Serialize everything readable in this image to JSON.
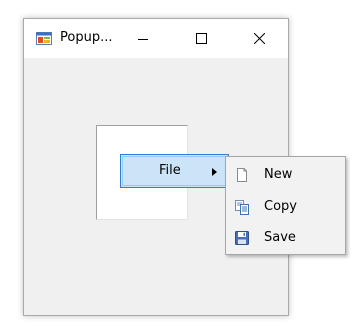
{
  "window": {
    "title": "Popup...",
    "app_icon": "windows-form-icon",
    "controls": {
      "minimize": "minimize-icon",
      "maximize": "maximize-icon",
      "close": "close-icon"
    }
  },
  "context_menu": {
    "file_label": "File",
    "file_arrow_icon": "submenu-arrow-icon",
    "submenu": [
      {
        "label": "New",
        "icon": "new-document-icon"
      },
      {
        "label": "Copy",
        "icon": "copy-icon"
      },
      {
        "label": "Save",
        "icon": "save-disk-icon"
      }
    ]
  },
  "colors": {
    "highlight_fill": "#cce4f7",
    "highlight_border": "#2d7fd6",
    "window_bg": "#f0f0f0"
  }
}
